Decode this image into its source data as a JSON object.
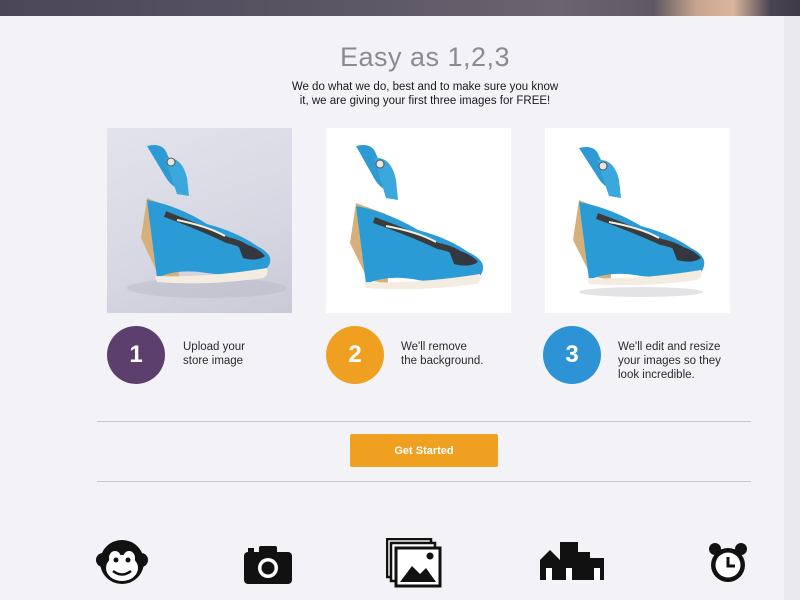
{
  "hero": {
    "image": "person-banner"
  },
  "section": {
    "title": "Easy as 1,2,3",
    "subtitle_line1": "We do what we do, best and to make sure you know",
    "subtitle_line2": "it, we are giving your first three images for FREE!"
  },
  "steps": [
    {
      "number": "1",
      "color": "#5c3f6d",
      "line1": "Upload your",
      "line2": "store image",
      "image": "shoe-original"
    },
    {
      "number": "2",
      "color": "#f0a020",
      "line1": "We'll remove",
      "line2": "the background.",
      "image": "shoe-background-removed"
    },
    {
      "number": "3",
      "color": "#2e93d5",
      "line1": "We'll edit and resize",
      "line2": "your images so they",
      "line3": "look incredible.",
      "image": "shoe-edited"
    }
  ],
  "cta": {
    "label": "Get Started",
    "color": "#f0a020"
  },
  "features": [
    {
      "icon": "monkey-icon"
    },
    {
      "icon": "camera-icon"
    },
    {
      "icon": "image-gallery-icon"
    },
    {
      "icon": "buildings-icon"
    },
    {
      "icon": "alarm-clock-icon"
    }
  ]
}
